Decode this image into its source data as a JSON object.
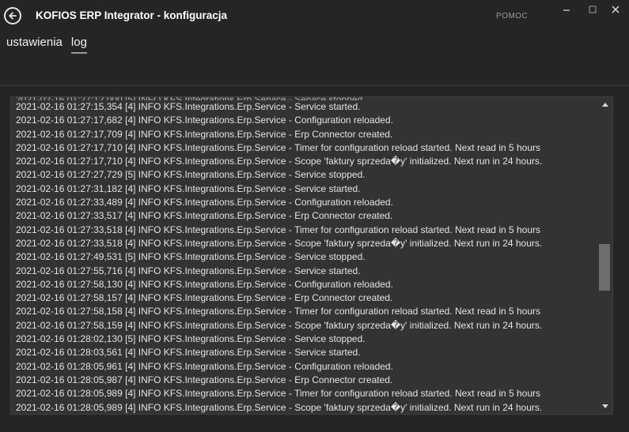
{
  "window": {
    "title": "KOFIOS ERP Integrator - konfiguracja",
    "help_label": "POMOC"
  },
  "tabs": [
    {
      "label": "ustawienia",
      "active": false
    },
    {
      "label": "log",
      "active": true
    }
  ],
  "log": {
    "lines": [
      "2021-02-16 01:27:15,354 [4] INFO KFS.Integrations.Erp.Service - Service started.",
      "2021-02-16 01:27:17,682 [4] INFO KFS.Integrations.Erp.Service - Configuration reloaded.",
      "2021-02-16 01:27:17,709 [4] INFO KFS.Integrations.Erp.Service - Erp Connector created.",
      "2021-02-16 01:27:17,710 [4] INFO KFS.Integrations.Erp.Service - Timer for configuration reload started. Next read in 5 hours",
      "2021-02-16 01:27:17,710 [4] INFO KFS.Integrations.Erp.Service - Scope 'faktury sprzeda�y' initialized. Next run in 24 hours.",
      "2021-02-16 01:27:27,729 [5] INFO KFS.Integrations.Erp.Service - Service stopped.",
      "2021-02-16 01:27:31,182 [4] INFO KFS.Integrations.Erp.Service - Service started.",
      "2021-02-16 01:27:33,489 [4] INFO KFS.Integrations.Erp.Service - Configuration reloaded.",
      "2021-02-16 01:27:33,517 [4] INFO KFS.Integrations.Erp.Service - Erp Connector created.",
      "2021-02-16 01:27:33,518 [4] INFO KFS.Integrations.Erp.Service - Timer for configuration reload started. Next read in 5 hours",
      "2021-02-16 01:27:33,518 [4] INFO KFS.Integrations.Erp.Service - Scope 'faktury sprzeda�y' initialized. Next run in 24 hours.",
      "2021-02-16 01:27:49,531 [5] INFO KFS.Integrations.Erp.Service - Service stopped.",
      "2021-02-16 01:27:55,716 [4] INFO KFS.Integrations.Erp.Service - Service started.",
      "2021-02-16 01:27:58,130 [4] INFO KFS.Integrations.Erp.Service - Configuration reloaded.",
      "2021-02-16 01:27:58,157 [4] INFO KFS.Integrations.Erp.Service - Erp Connector created.",
      "2021-02-16 01:27:58,158 [4] INFO KFS.Integrations.Erp.Service - Timer for configuration reload started. Next read in 5 hours",
      "2021-02-16 01:27:58,159 [4] INFO KFS.Integrations.Erp.Service - Scope 'faktury sprzeda�y' initialized. Next run in 24 hours.",
      "2021-02-16 01:28:02,130 [5] INFO KFS.Integrations.Erp.Service - Service stopped.",
      "2021-02-16 01:28:03,561 [4] INFO KFS.Integrations.Erp.Service - Service started.",
      "2021-02-16 01:28:05,961 [4] INFO KFS.Integrations.Erp.Service - Configuration reloaded.",
      "2021-02-16 01:28:05,987 [4] INFO KFS.Integrations.Erp.Service - Erp Connector created.",
      "2021-02-16 01:28:05,989 [4] INFO KFS.Integrations.Erp.Service - Timer for configuration reload started. Next read in 5 hours",
      "2021-02-16 01:28:05,989 [4] INFO KFS.Integrations.Erp.Service - Scope 'faktury sprzeda�y' initialized. Next run in 24 hours."
    ]
  },
  "colors": {
    "background": "#252525",
    "log_background": "#333333",
    "text": "#e4e4e4",
    "scroll_thumb": "#6e6e6e"
  }
}
